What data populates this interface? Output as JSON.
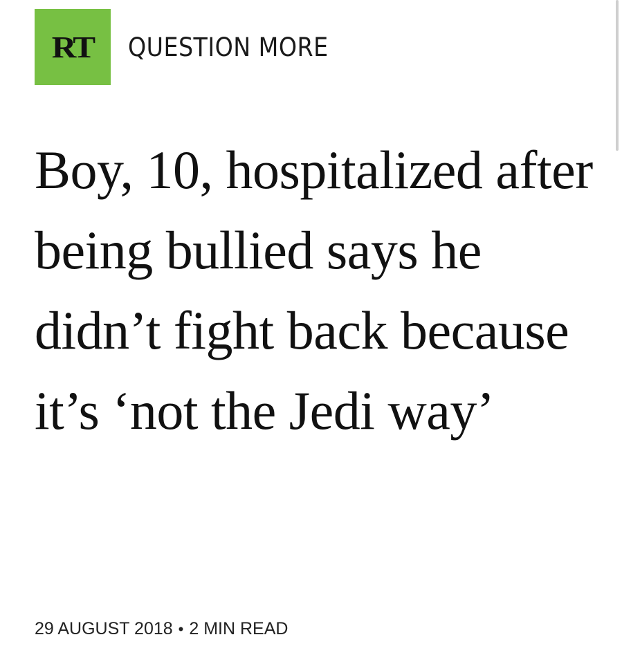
{
  "header": {
    "logo_text": "RT",
    "tagline": "QUESTION MORE",
    "brand_color": "#77c043"
  },
  "article": {
    "headline": "Boy, 10, hospitalized after being bullied says he didn’t fight back because it’s ‘not the Jedi way’",
    "date": "29 AUGUST 2018",
    "separator": "•",
    "read_time": "2 MIN READ"
  }
}
